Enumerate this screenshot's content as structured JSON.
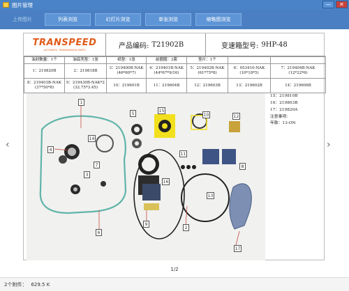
{
  "window": {
    "title": "图片管理",
    "min_label": "—",
    "close_label": "✕"
  },
  "toolbar": {
    "upload": "上传图片",
    "tabs": [
      "列表浏览",
      "幻灯片浏览",
      "单张浏览",
      "缩略图浏览"
    ]
  },
  "nav": {
    "prev": "‹",
    "next": "›"
  },
  "sheet": {
    "brand": "TRANSPEED",
    "brand_sub": "AUTOMATIC TRANSMISSION PARTS",
    "code_label": "产品编码:",
    "code_value": "T21902B",
    "gearbox_label": "变速箱型号:",
    "gearbox_value": "9HP-48",
    "row0": [
      "油封数量：1个",
      "油底壳垫：1张",
      "纸垫：1张",
      "前圈圈：2套",
      "垫片：1个",
      "",
      ""
    ],
    "row1": [
      "1：219820B",
      "2：219818B",
      "3：219400B-NAK (46*60*7)",
      "4：219401B-NAK (44*67*9/16)",
      "5：219402B-NAK (61*75*8)",
      "6：053410-NAK (10*18*5)",
      "7：219404B-NAK (12*22*6)"
    ],
    "row2": [
      "8：219403B-NAK (37*50*8)",
      "9：219430B-NAK*2 (32.75*3.45)",
      "10：219601B",
      "11：219604B",
      "12：219603B",
      "13：219602B",
      "14：219606B"
    ],
    "side_notes": [
      "15：219810B",
      "16：219803B",
      "17：219820A",
      "注意事项:",
      "年款：13-ON"
    ]
  },
  "photo": {
    "callouts": [
      "1",
      "2",
      "3",
      "4",
      "5",
      "6",
      "7",
      "8",
      "9",
      "10",
      "11",
      "12",
      "13",
      "14",
      "15",
      "16",
      "17"
    ]
  },
  "footer": {
    "page": "1/2",
    "attachments": "2个附件：",
    "size": "629.5 K"
  },
  "colors": {
    "titlebar": "#4a83c7",
    "toolbar": "#4a80c3",
    "brand": "#e05a1a",
    "gasket": "#5fb4a9",
    "callout_line": "#c0392b"
  }
}
